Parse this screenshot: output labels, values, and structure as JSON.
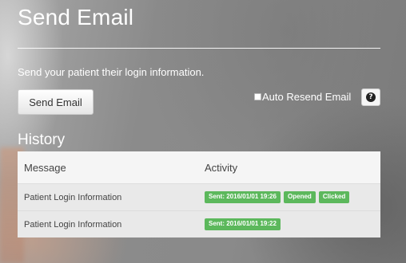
{
  "header": {
    "title": "Send Email"
  },
  "send_section": {
    "instruction": "Send your patient their login information.",
    "send_button_label": "Send Email",
    "auto_resend_label": "Auto Resend Email",
    "auto_resend_checked": false,
    "help_icon": "question-circle-icon",
    "help_glyph": "?"
  },
  "history": {
    "title": "History",
    "columns": {
      "message": "Message",
      "activity": "Activity"
    },
    "rows": [
      {
        "message": "Patient Login Information",
        "badges": [
          "Sent: 2016/01/01 19:26",
          "Opened",
          "Clicked"
        ]
      },
      {
        "message": "Patient Login Information",
        "badges": [
          "Sent: 2016/01/01 19:22"
        ]
      }
    ]
  },
  "colors": {
    "badge_success": "#5cb85c",
    "table_background": "#f2f2f2",
    "text_light": "#ffffff"
  }
}
